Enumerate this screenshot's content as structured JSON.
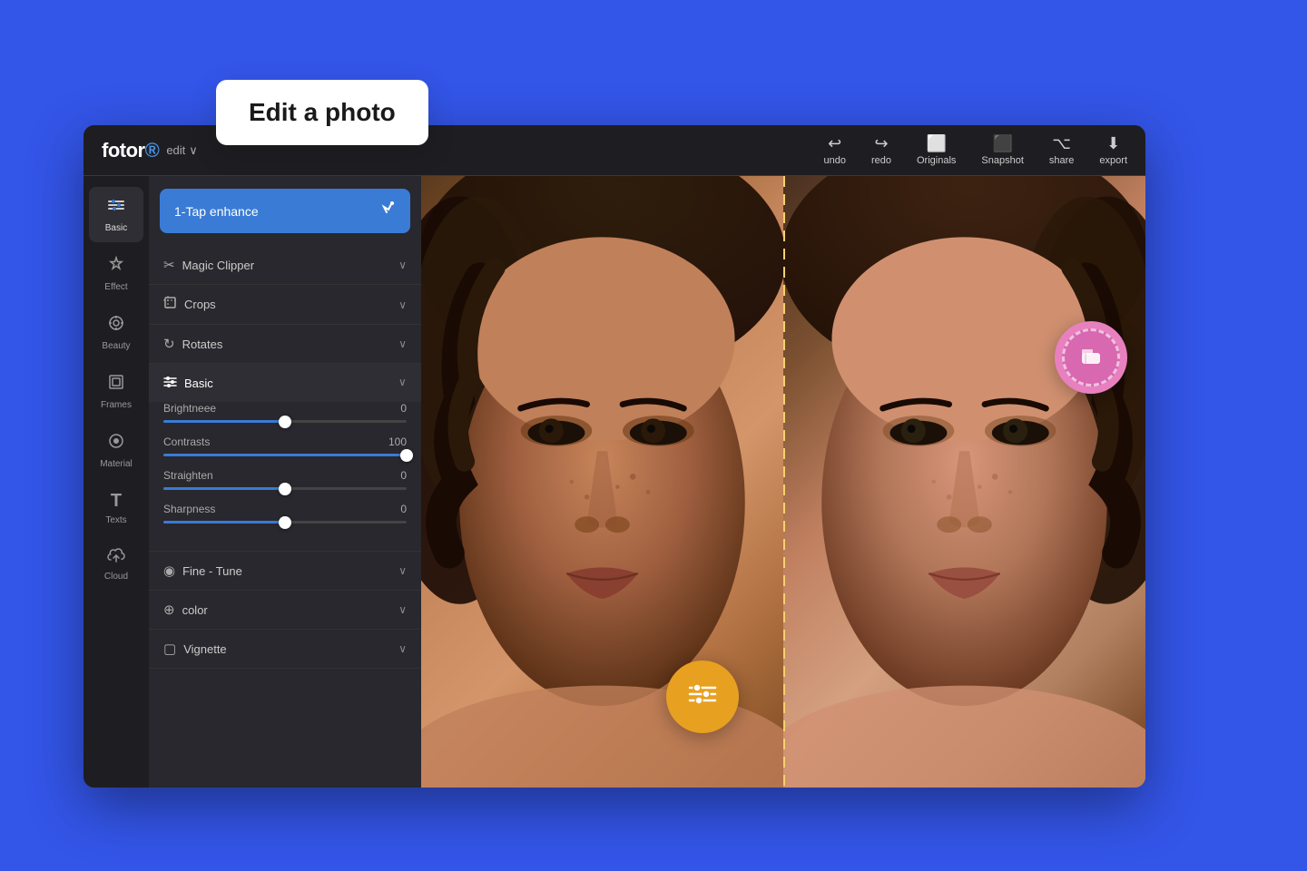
{
  "tooltip": {
    "title": "Edit a photo"
  },
  "app": {
    "logo": "fotor",
    "logo_dot": "®",
    "toolbar": {
      "edit_label": "edit",
      "actions": [
        {
          "id": "undo",
          "icon": "↩",
          "label": "undo"
        },
        {
          "id": "redo",
          "icon": "↪",
          "label": "redo"
        },
        {
          "id": "originals",
          "icon": "🖼",
          "label": "Originals"
        },
        {
          "id": "snapshot",
          "icon": "📷",
          "label": "Snapshot"
        },
        {
          "id": "share",
          "icon": "⎘",
          "label": "share"
        },
        {
          "id": "export",
          "icon": "⬇",
          "label": "export"
        }
      ]
    },
    "nav": {
      "items": [
        {
          "id": "basic",
          "icon": "≡",
          "label": "Basic",
          "active": true
        },
        {
          "id": "effect",
          "icon": "⚗",
          "label": "Effect"
        },
        {
          "id": "beauty",
          "icon": "✦",
          "label": "Beauty"
        },
        {
          "id": "frames",
          "icon": "▣",
          "label": "Frames"
        },
        {
          "id": "material",
          "icon": "◎",
          "label": "Material"
        },
        {
          "id": "texts",
          "icon": "T",
          "label": "Texts"
        },
        {
          "id": "cloud",
          "icon": "☁",
          "label": "Cloud"
        }
      ]
    },
    "panel": {
      "enhance_btn_label": "1-Tap enhance",
      "sections": [
        {
          "id": "magic-clipper",
          "icon": "✂",
          "label": "Magic Clipper",
          "expanded": false
        },
        {
          "id": "crops",
          "icon": "⊡",
          "label": "Crops",
          "expanded": false
        },
        {
          "id": "rotates",
          "icon": "↻",
          "label": "Rotates",
          "expanded": false
        },
        {
          "id": "basic",
          "icon": "⇌",
          "label": "Basic",
          "expanded": true
        },
        {
          "id": "fine-tune",
          "icon": "◉",
          "label": "Fine - Tune",
          "expanded": false
        },
        {
          "id": "color",
          "icon": "⊕",
          "label": "color",
          "expanded": false
        },
        {
          "id": "vignette",
          "icon": "▢",
          "label": "Vignette",
          "expanded": false
        }
      ],
      "sliders": [
        {
          "id": "brightness",
          "label": "Brightneee",
          "value": 0,
          "percent": 50
        },
        {
          "id": "contrasts",
          "label": "Contrasts",
          "value": 100,
          "percent": 100
        },
        {
          "id": "straighten",
          "label": "Straighten",
          "value": 0,
          "percent": 50
        },
        {
          "id": "sharpness",
          "label": "Sharpness",
          "value": 0,
          "percent": 50
        }
      ]
    }
  },
  "floats": {
    "eraser_icon": "✏",
    "sliders_icon": "⚙"
  }
}
